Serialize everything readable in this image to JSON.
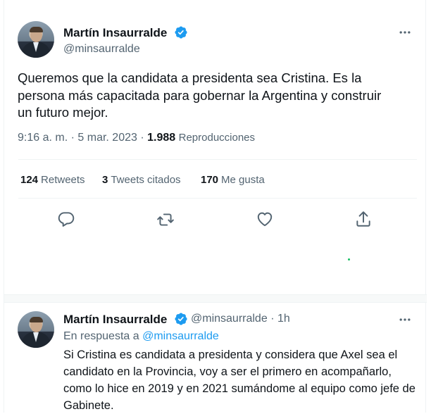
{
  "tweet": {
    "author_name": "Martín Insaurralde",
    "author_handle": "@minsaurralde",
    "text": "Queremos que la candidata a presidenta sea Cristina. Es la persona más capacitada para gobernar la Argentina y construir un futuro mejor.",
    "time": "9:16 a. m.",
    "date": "5 mar. 2023",
    "views_count": "1.988",
    "views_label": "Reproducciones",
    "stats": {
      "retweets_count": "124",
      "retweets_label": "Retweets",
      "quotes_count": "3",
      "quotes_label": "Tweets citados",
      "likes_count": "170",
      "likes_label": "Me gusta"
    },
    "icons": [
      "reply-icon",
      "retweet-icon",
      "like-icon",
      "share-icon",
      "more-icon",
      "verified-badge-icon"
    ]
  },
  "reply": {
    "author_name": "Martín Insaurralde",
    "author_handle": "@minsaurralde",
    "time_ago": "1h",
    "replying_prefix": "En respuesta a",
    "replying_handle": "@minsaurralde",
    "text": "Si Cristina es candidata a presidenta y considera que Axel sea el candidato en la Provincia, voy a ser el primero en acompañarlo, como lo hice en 2019 y en 2021 sumándome al equipo como jefe de Gabinete."
  },
  "colors": {
    "text_primary": "#0f1419",
    "text_secondary": "#536471",
    "accent": "#1d9bf0",
    "border": "#eff3f4"
  }
}
